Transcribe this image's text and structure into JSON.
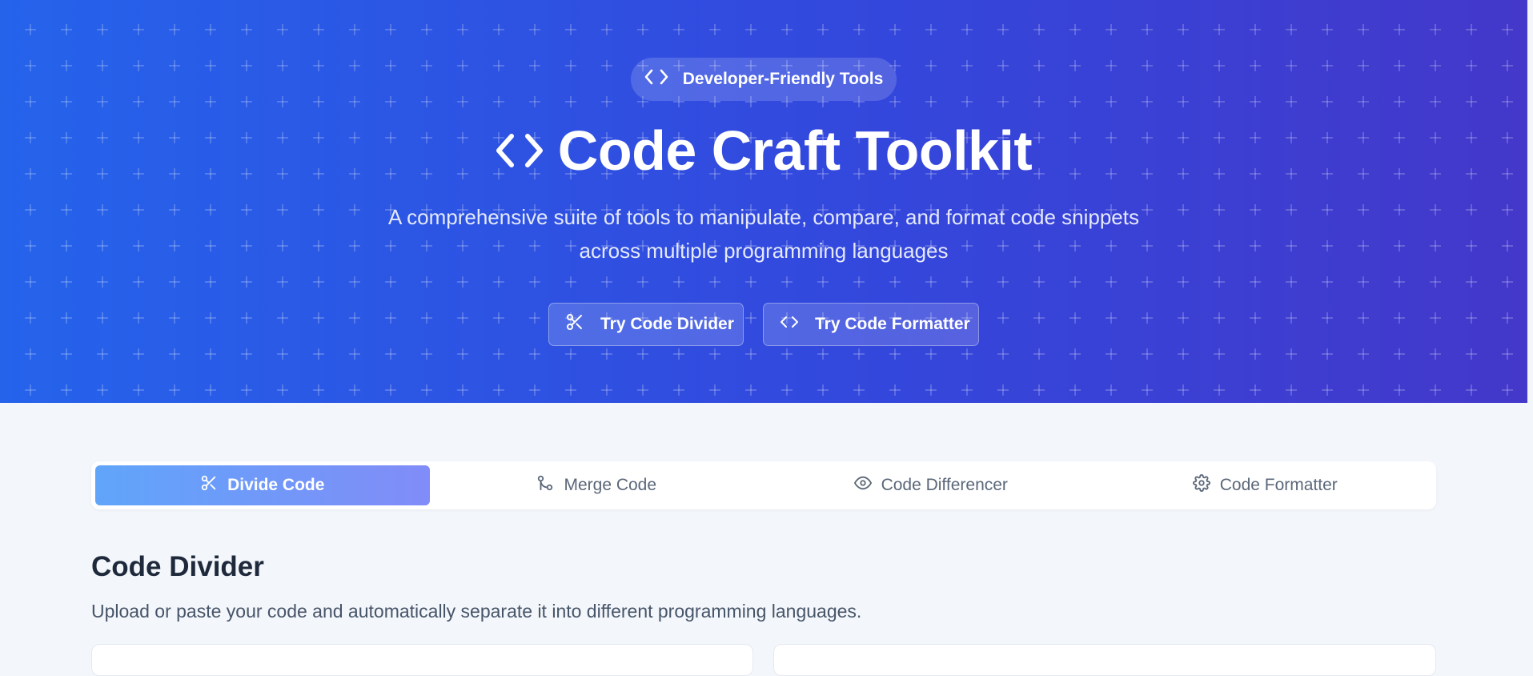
{
  "hero": {
    "badge_label": "Developer-Friendly Tools",
    "title": "Code Craft Toolkit",
    "subtitle_line1": "A comprehensive suite of tools to manipulate, compare, and format code snippets",
    "subtitle_line2": "across multiple programming languages",
    "buttons": [
      {
        "label": "Try Code Divider",
        "icon": "scissors-icon"
      },
      {
        "label": "Try Code Formatter",
        "icon": "code-icon"
      }
    ],
    "gradient_start": "#2563eb",
    "gradient_end": "#4338ca"
  },
  "tabs": [
    {
      "label": "Divide Code",
      "icon": "scissors-icon",
      "active": true
    },
    {
      "label": "Merge Code",
      "icon": "git-merge-icon",
      "active": false
    },
    {
      "label": "Code Differencer",
      "icon": "eye-icon",
      "active": false
    },
    {
      "label": "Code Formatter",
      "icon": "gear-icon",
      "active": false
    }
  ],
  "section": {
    "title": "Code Divider",
    "description": "Upload or paste your code and automatically separate it into different programming languages."
  }
}
